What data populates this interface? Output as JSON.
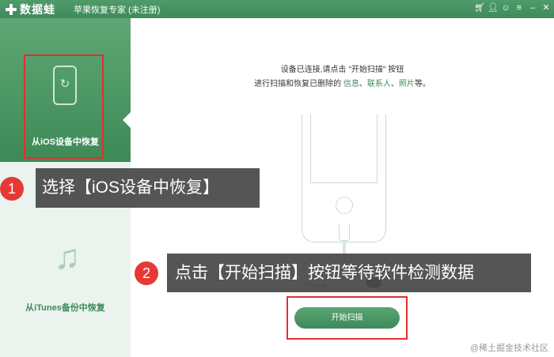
{
  "titlebar": {
    "logo_text": "数据蛙",
    "app_title": "苹果恢复专家 (未注册)",
    "controls": [
      "cart-icon",
      "user-icon",
      "chat-icon",
      "menu-icon",
      "minimize-icon",
      "close-icon"
    ]
  },
  "sidebar": {
    "items": [
      {
        "label": "从iOS设备中恢复",
        "icon": "phone-restore-icon",
        "active": true
      },
      {
        "label": "从iTunes备份中恢复",
        "icon": "music-note-icon",
        "active": false
      }
    ]
  },
  "main": {
    "message_line1": "设备已连接,请点击 \"开始扫描\" 按钮",
    "message_line2_prefix": "进行扫描和恢复已删除的 ",
    "message_links": [
      "信息",
      "联系人",
      "照片"
    ],
    "message_sep": "、",
    "message_line2_suffix": "等。",
    "device_label": "iPhone",
    "scan_button": "开始扫描"
  },
  "annotations": {
    "step1_number": "1",
    "step1_text": "选择【iOS设备中恢复】",
    "step2_number": "2",
    "step2_text": "点击【开始扫描】按钮等待软件检测数据"
  },
  "watermark": "@稀土掘金技术社区",
  "colors": {
    "brand_green": "#3f8a5b",
    "highlight_red": "#e0302e",
    "badge_red": "#e53935"
  }
}
